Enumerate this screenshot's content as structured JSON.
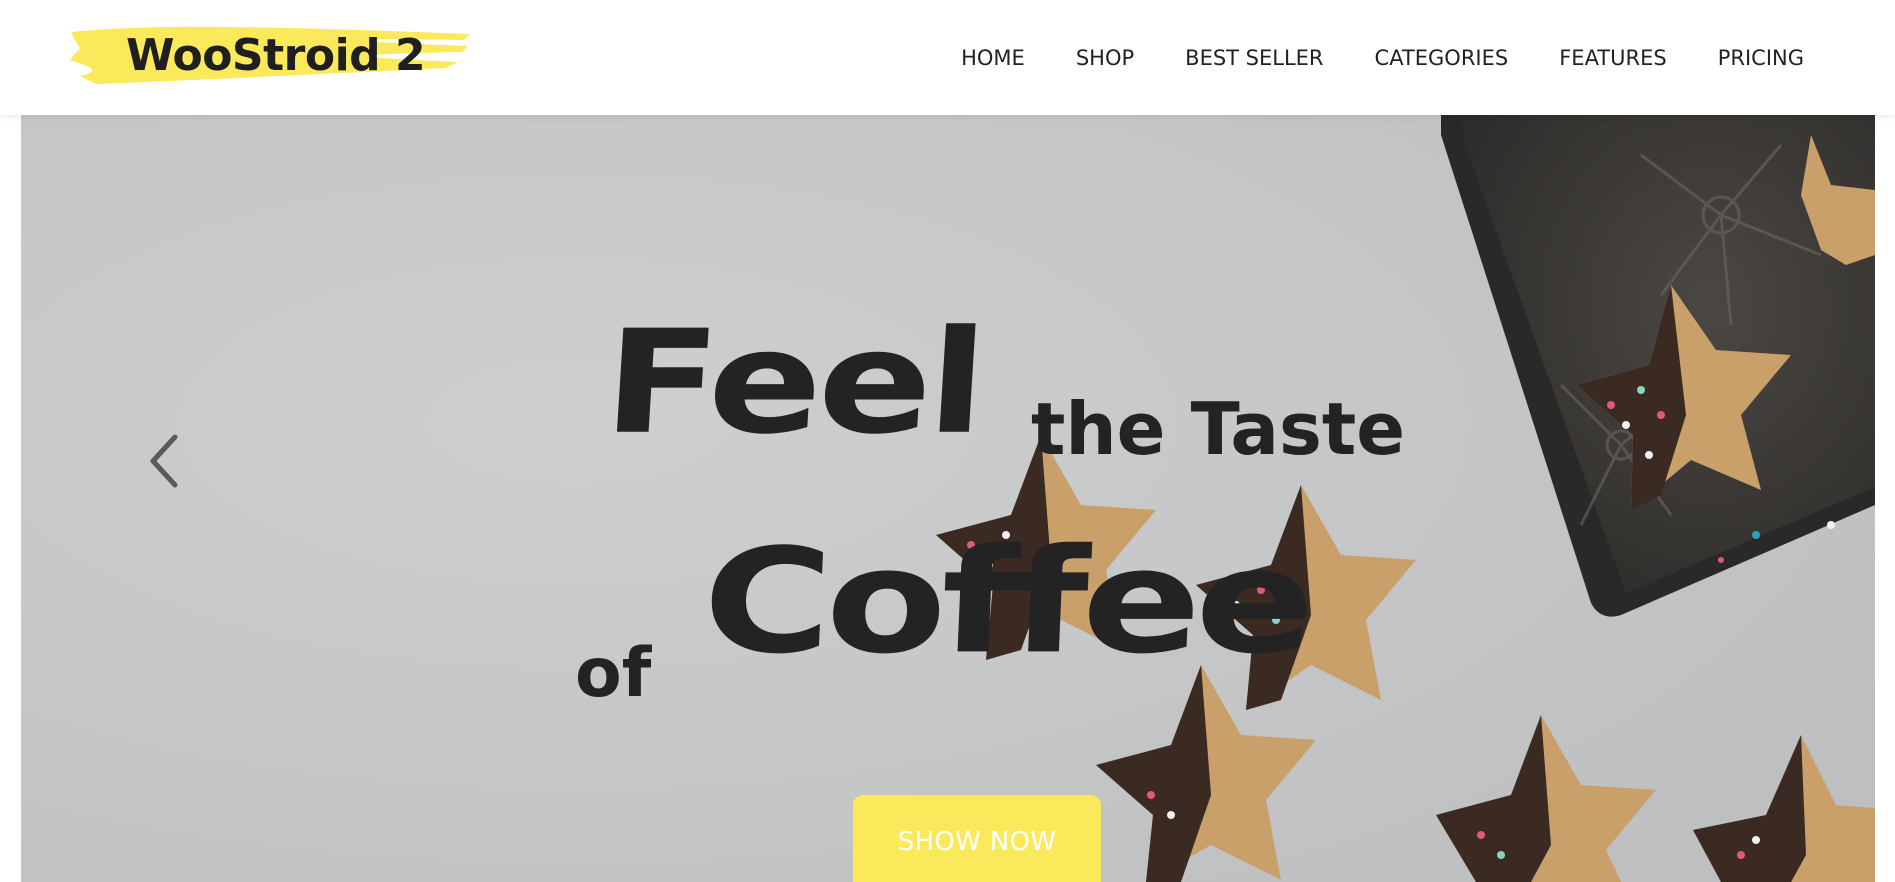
{
  "brand": {
    "name": "WooStroid 2",
    "accent_color": "#fbe95c"
  },
  "nav": {
    "items": [
      {
        "label": "HOME"
      },
      {
        "label": "SHOP"
      },
      {
        "label": "BEST SELLER"
      },
      {
        "label": "CATEGORIES"
      },
      {
        "label": "FEATURES"
      },
      {
        "label": "PRICING"
      }
    ]
  },
  "hero": {
    "headline": {
      "word1": "Feel",
      "word2": "the Taste",
      "word3": "of",
      "word4": "Coffee"
    },
    "cta_label": "SHOW NOW",
    "prev_icon": "chevron-left-icon",
    "background_color": "#c6c8ca",
    "text_color": "#232323"
  }
}
